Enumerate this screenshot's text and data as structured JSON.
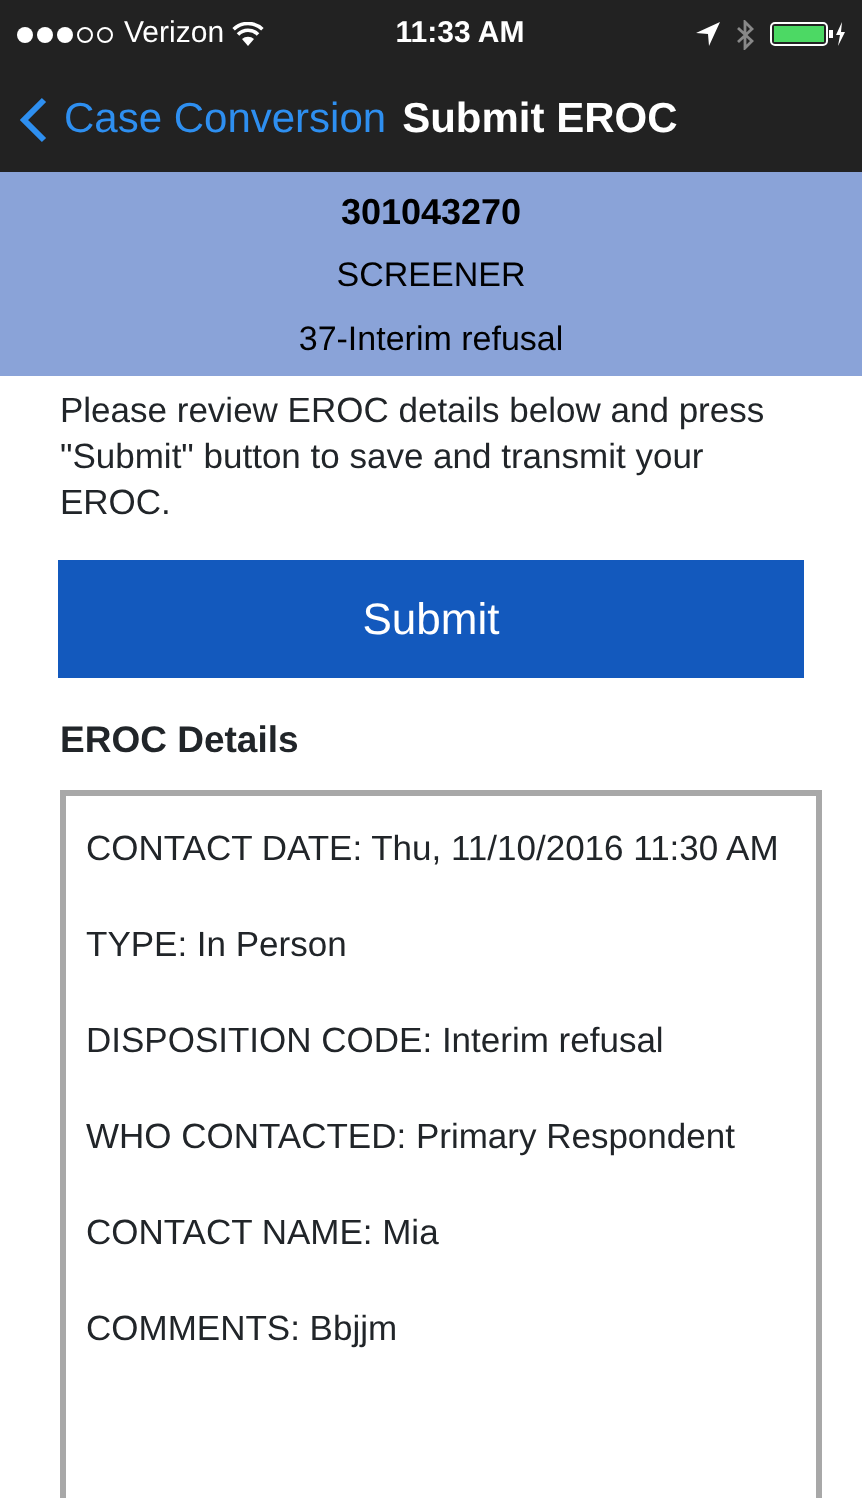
{
  "status_bar": {
    "carrier": "Verizon",
    "time": "11:33 AM"
  },
  "nav_bar": {
    "back_label": "Case Conversion",
    "title": "Submit EROC"
  },
  "case_header": {
    "case_id": "301043270",
    "role": "SCREENER",
    "disposition": "37-Interim refusal"
  },
  "instructions": "Please review EROC details below and press \"Submit\" button to save and transmit your EROC.",
  "submit_button": "Submit",
  "details": {
    "heading": "EROC Details",
    "items": [
      "CONTACT DATE: Thu, 11/10/2016 11:30 AM",
      "TYPE: In Person",
      "DISPOSITION CODE: Interim refusal",
      "WHO CONTACTED: Primary Respondent",
      "CONTACT NAME: Mia",
      "COMMENTS: Bbjjm"
    ]
  }
}
